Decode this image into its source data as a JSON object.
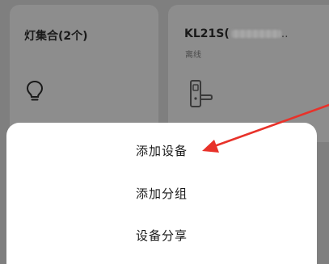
{
  "cards": [
    {
      "title": "灯集合(2个)",
      "status": "",
      "icon": "lightbulb-icon"
    },
    {
      "title": "KL21S(",
      "title_suffix": "..",
      "status": "离线",
      "icon": "smart-lock-icon"
    }
  ],
  "menu": {
    "items": [
      "添加设备",
      "添加分组",
      "设备分享"
    ]
  },
  "annotation": {
    "color": "#e8322a",
    "points_to": "添加设备"
  },
  "colors": {
    "overlay_background": "#7f7f7f",
    "card_background": "#8d8d8d",
    "sheet_background": "#ffffff"
  }
}
